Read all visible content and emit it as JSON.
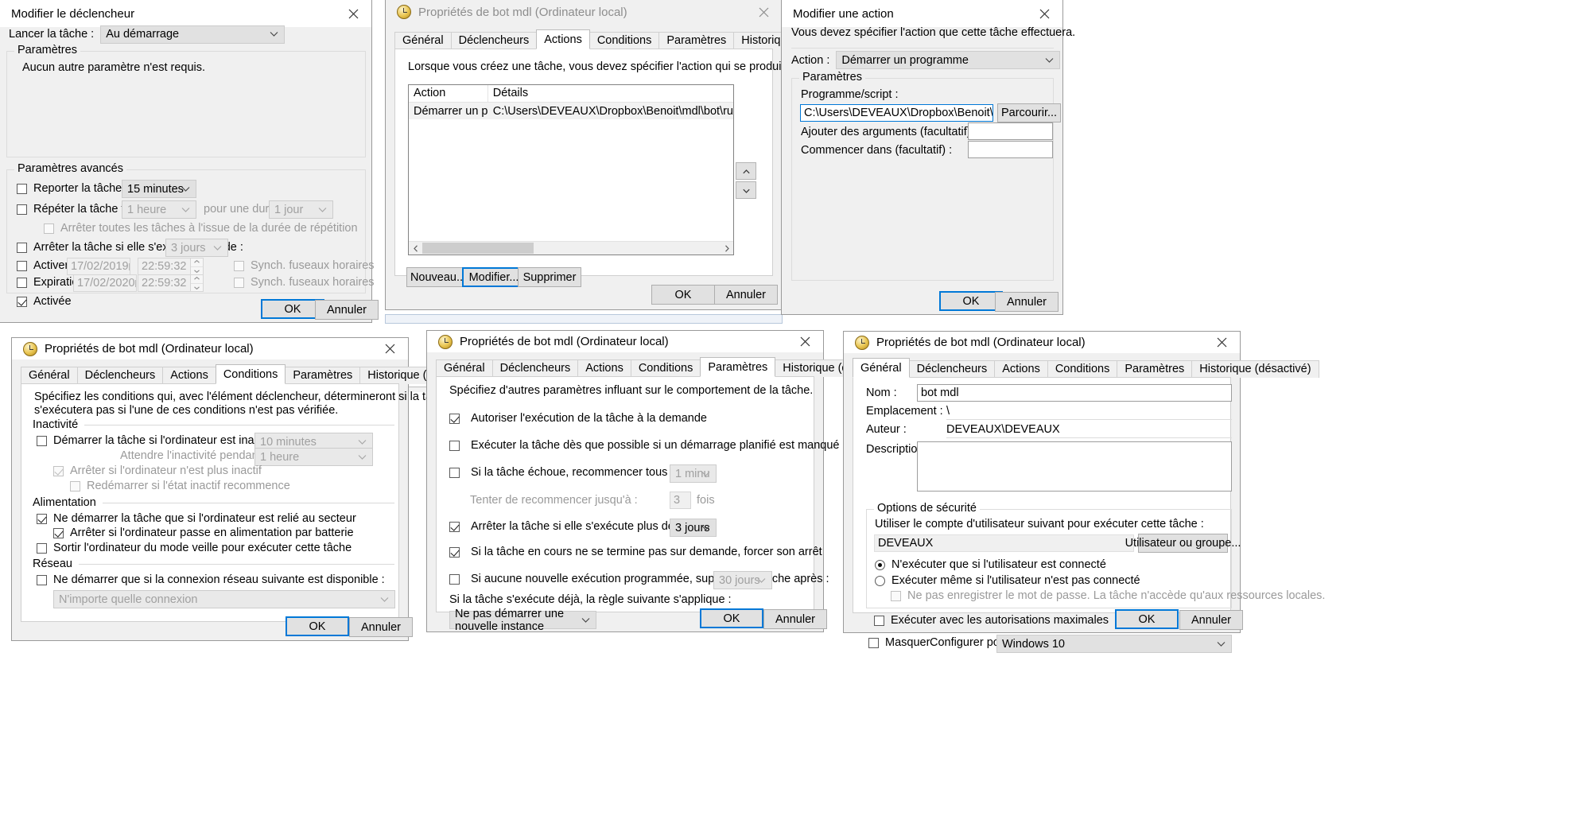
{
  "trigger_dialog": {
    "title": "Modifier le déclencheur",
    "close_icon": "close-icon",
    "start_task_label": "Lancer la tâche :",
    "start_task_value": "Au démarrage",
    "settings_group": "Paramètres",
    "settings_text": "Aucun autre paramètre n'est requis.",
    "advanced_group": "Paramètres avancés",
    "delay_label": "Reporter la tâche pendant :",
    "delay_value": "15 minutes",
    "repeat_label": "Répéter la tâche toutes les :",
    "repeat_value": "1 heure",
    "duration_label": "pour une durée de :",
    "duration_value": "1 jour",
    "stop_all_label": "Arrêter toutes les tâches à l'issue de la durée de répétition",
    "stop_if_runs_label": "Arrêter la tâche si elle s'exécute plus de :",
    "stop_if_runs_value": "3 jours",
    "activate_label": "Activer :",
    "activate_date": "17/02/2019",
    "activate_time": "22:59:32",
    "expire_label": "Expiration :",
    "expire_date": "17/02/2020",
    "expire_time": "22:59:32",
    "sync_tz_label": "Synch. fuseaux horaires",
    "enabled_label": "Activée",
    "ok": "OK",
    "cancel": "Annuler"
  },
  "actions_dialog": {
    "title": "Propriétés de bot mdl (Ordinateur local)",
    "tabs": [
      {
        "label": "Général",
        "active": false
      },
      {
        "label": "Déclencheurs",
        "active": false
      },
      {
        "label": "Actions",
        "active": true
      },
      {
        "label": "Conditions",
        "active": false
      },
      {
        "label": "Paramètres",
        "active": false
      },
      {
        "label": "Historique (désactivé)",
        "active": false
      }
    ],
    "description": "Lorsque vous créez une tâche, vous devez spécifier l'action qui se produira au démarrage de la tâche.",
    "columns": [
      "Action",
      "Détails"
    ],
    "rows": [
      {
        "action": "Démarrer un progr...",
        "details": "C:\\Users\\DEVEAUX\\Dropbox\\Benoit\\mdl\\bot\\run.bat"
      }
    ],
    "move_up_icon": "arrow-up-icon",
    "move_down_icon": "arrow-down-icon",
    "new": "Nouveau...",
    "edit": "Modifier...",
    "delete": "Supprimer",
    "ok": "OK",
    "cancel": "Annuler"
  },
  "edit_action_dialog": {
    "title": "Modifier une action",
    "instruction": "Vous devez spécifier l'action que cette tâche effectuera.",
    "action_label": "Action :",
    "action_value": "Démarrer un programme",
    "params_group": "Paramètres",
    "program_label": "Programme/script :",
    "program_value": "C:\\Users\\DEVEAUX\\Dropbox\\Benoit\\mdl\\bot\\run.bat",
    "browse": "Parcourir...",
    "args_label": "Ajouter des arguments (facultatif) :",
    "args_value": "",
    "startin_label": "Commencer dans (facultatif) :",
    "startin_value": "",
    "ok": "OK",
    "cancel": "Annuler"
  },
  "conditions_dialog": {
    "title": "Propriétés de bot mdl (Ordinateur local)",
    "tabs": [
      {
        "label": "Général",
        "active": false
      },
      {
        "label": "Déclencheurs",
        "active": false
      },
      {
        "label": "Actions",
        "active": false
      },
      {
        "label": "Conditions",
        "active": true
      },
      {
        "label": "Paramètres",
        "active": false
      },
      {
        "label": "Historique (désactivé)",
        "active": false
      }
    ],
    "description_line1": "Spécifiez les conditions qui, avec l'élément déclencheur, détermineront si la tâche doit s'exécuter. Elle ne",
    "description_line2": "s'exécutera pas si l'une de ces conditions n'est pas vérifiée.",
    "idle_group": "Inactivité",
    "idle_start_label": "Démarrer la tâche si l'ordinateur est inactif pendant :",
    "idle_start_value": "10 minutes",
    "idle_wait_label": "Attendre l'inactivité pendant :",
    "idle_wait_value": "1 heure",
    "idle_stop_label": "Arrêter si l'ordinateur n'est plus inactif",
    "idle_restart_label": "Redémarrer si l'état inactif recommence",
    "power_group": "Alimentation",
    "power_ac_label": "Ne démarrer la tâche que si l'ordinateur est relié au secteur",
    "power_battery_label": "Arrêter si l'ordinateur passe en alimentation par batterie",
    "power_wake_label": "Sortir l'ordinateur du mode veille pour exécuter cette tâche",
    "network_group": "Réseau",
    "network_label": "Ne démarrer que si la connexion réseau suivante est disponible :",
    "network_value": "N'importe quelle connexion",
    "ok": "OK",
    "cancel": "Annuler"
  },
  "settings_dialog": {
    "title": "Propriétés de bot mdl (Ordinateur local)",
    "tabs": [
      {
        "label": "Général",
        "active": false
      },
      {
        "label": "Déclencheurs",
        "active": false
      },
      {
        "label": "Actions",
        "active": false
      },
      {
        "label": "Conditions",
        "active": false
      },
      {
        "label": "Paramètres",
        "active": true
      },
      {
        "label": "Historique (désactivé)",
        "active": false
      }
    ],
    "description": "Spécifiez d'autres paramètres influant sur le comportement de la tâche.",
    "allow_on_demand": "Autoriser l'exécution de la tâche à la demande",
    "run_asap": "Exécuter la tâche dès que possible si un démarrage planifié est manqué",
    "retry_label": "Si la tâche échoue, recommencer tous les :",
    "retry_value": "1 minu",
    "retry_count_label": "Tenter de recommencer jusqu'à :",
    "retry_count_value": "3",
    "retry_count_unit": "fois",
    "stop_if_runs_label": "Arrêter la tâche si elle s'exécute plus de :",
    "stop_if_runs_value": "3 jours",
    "force_stop_label": "Si la tâche en cours ne se termine pas sur demande, forcer son arrêt",
    "delete_label": "Si aucune nouvelle exécution programmée, supprimer la tâche après :",
    "delete_value": "30 jours",
    "rule_label": "Si la tâche s'exécute déjà, la règle suivante s'applique :",
    "rule_value": "Ne pas démarrer une nouvelle instance",
    "ok": "OK",
    "cancel": "Annuler"
  },
  "general_dialog": {
    "title": "Propriétés de bot mdl (Ordinateur local)",
    "tabs": [
      {
        "label": "Général",
        "active": true
      },
      {
        "label": "Déclencheurs",
        "active": false
      },
      {
        "label": "Actions",
        "active": false
      },
      {
        "label": "Conditions",
        "active": false
      },
      {
        "label": "Paramètres",
        "active": false
      },
      {
        "label": "Historique (désactivé)",
        "active": false
      }
    ],
    "name_label": "Nom :",
    "name_value": "bot mdl",
    "location_label": "Emplacement :",
    "location_value": "\\",
    "author_label": "Auteur :",
    "author_value": "DEVEAUX\\DEVEAUX",
    "description_label": "Description :",
    "description_value": "",
    "security_group": "Options de sécurité",
    "security_text": "Utiliser le compte d'utilisateur suivant pour exécuter cette tâche :",
    "account_value": "DEVEAUX",
    "change_user_btn": "Utilisateur ou groupe...",
    "run_only_logged": "N'exécuter que si l'utilisateur est connecté",
    "run_whether": "Exécuter même si l'utilisateur n'est pas connecté",
    "no_store_password": "Ne pas enregistrer le mot de passe. La tâche n'accède qu'aux ressources locales.",
    "highest_priv": "Exécuter avec les autorisations maximales",
    "hidden_label": "Masquer",
    "configure_label": "Configurer pour :",
    "configure_value": "Windows 10",
    "ok": "OK",
    "cancel": "Annuler"
  },
  "colors": {
    "accent": "#0078d7",
    "dialog_bg": "#f0f0f0",
    "panel_bg": "#ffffff",
    "disabled_text": "#9a9a9a"
  }
}
